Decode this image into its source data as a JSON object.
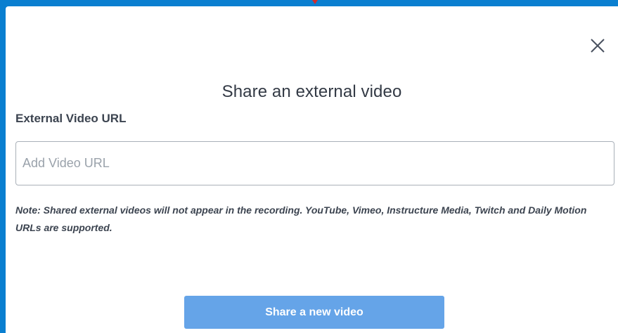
{
  "modal": {
    "title": "Share an external video",
    "field_label": "External Video URL",
    "url_input": {
      "value": "",
      "placeholder": "Add Video URL"
    },
    "note": "Note: Shared external videos will not appear in the recording. YouTube, Vimeo, Instructure Media, Twitch and Daily Motion URLs are supported.",
    "submit_label": "Share a new video",
    "close_icon": "close-icon"
  },
  "colors": {
    "background": "#0a7fd0",
    "button": "#65a4e8",
    "text": "#333a45"
  }
}
